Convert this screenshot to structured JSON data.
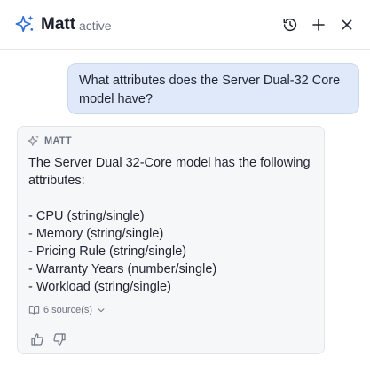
{
  "header": {
    "title": "Matt",
    "status": "active",
    "icons": {
      "logo": "sparkle-icon",
      "history": "history-icon",
      "add": "plus-icon",
      "close": "close-icon"
    }
  },
  "conversation": {
    "user_message": "What attributes does the Server Dual-32 Core model have?",
    "assistant": {
      "name": "MATT",
      "intro": "The Server Dual 32-Core model has the following attributes:",
      "attributes": [
        "- CPU (string/single)",
        "- Memory (string/single)",
        "- Pricing Rule (string/single)",
        "- Warranty Years (number/single)",
        "- Workload (string/single)"
      ],
      "sources_label": "6 source(s)"
    }
  },
  "colors": {
    "accent": "#2f6fd6",
    "user_bubble": "#dfe9f9",
    "reply_bg": "#f6f7f9",
    "muted_text": "#6b7280"
  }
}
